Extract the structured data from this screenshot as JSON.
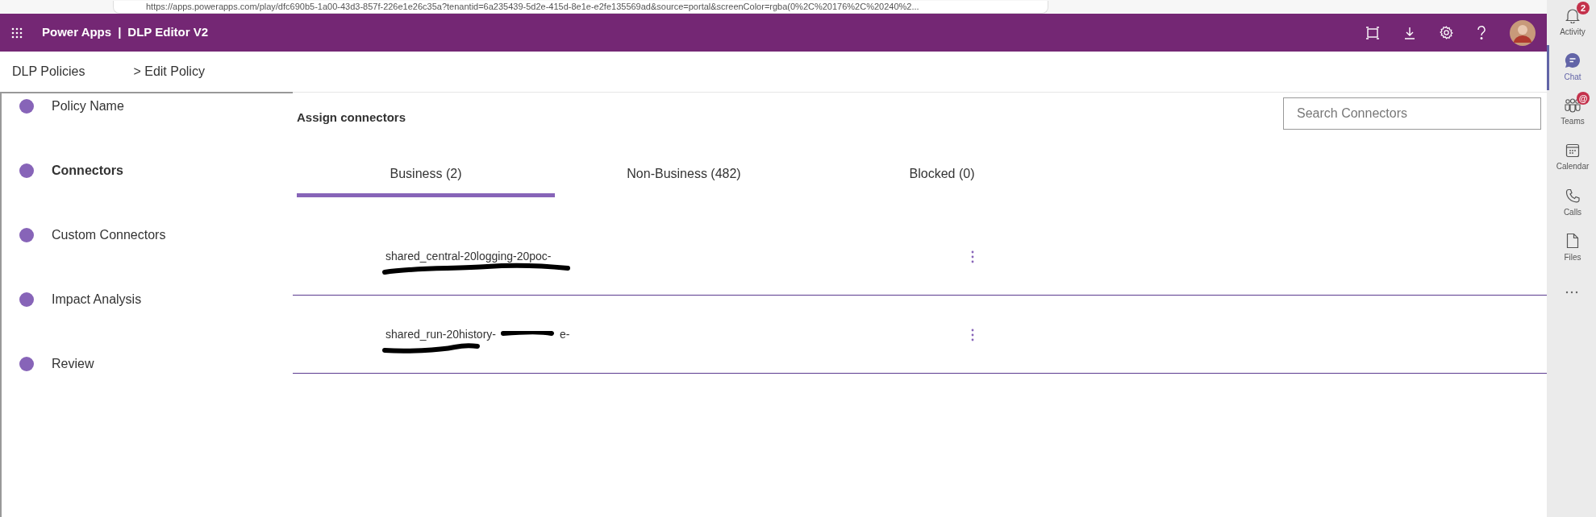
{
  "browser": {
    "url": "https://apps.powerapps.com/play/dfc690b5-1a00-43d3-857f-226e1e26c35a?tenantid=6a235439-5d2e-415d-8e1e-e2fe135569ad&source=portal&screenColor=rgba(0%2C%20176%2C%20240%2..."
  },
  "app_bar": {
    "app_name": "Power Apps",
    "separator": "|",
    "title": "DLP Editor V2"
  },
  "breadcrumbs": [
    {
      "label": "DLP Policies"
    },
    {
      "label": "> Edit Policy"
    }
  ],
  "steps": [
    {
      "label": "Policy Name",
      "selected": false
    },
    {
      "label": "Connectors",
      "selected": true
    },
    {
      "label": "Custom Connectors",
      "selected": false
    },
    {
      "label": "Impact Analysis",
      "selected": false
    },
    {
      "label": "Review",
      "selected": false
    }
  ],
  "section_title": "Assign connectors",
  "search": {
    "placeholder": "Search Connectors"
  },
  "tabs": [
    {
      "label": "Business (2)",
      "selected": true
    },
    {
      "label": "Non-Business (482)",
      "selected": false
    },
    {
      "label": "Blocked (0)",
      "selected": false
    }
  ],
  "connectors": [
    {
      "name": "shared_central-20logging-20poc-"
    },
    {
      "name": "shared_run-20history-",
      "tail": "e-"
    }
  ],
  "rail": [
    {
      "label": "Activity",
      "selected": false,
      "badge": "2"
    },
    {
      "label": "Chat",
      "selected": true
    },
    {
      "label": "Teams",
      "selected": false,
      "badge": "@"
    },
    {
      "label": "Calendar",
      "selected": false
    },
    {
      "label": "Calls",
      "selected": false
    },
    {
      "label": "Files",
      "selected": false
    }
  ]
}
